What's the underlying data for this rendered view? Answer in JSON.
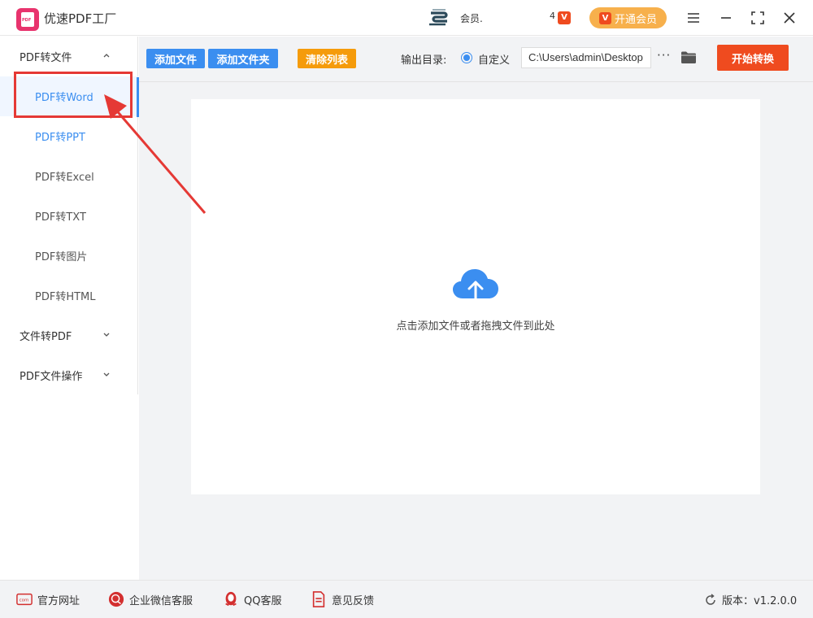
{
  "app": {
    "title": "优速PDF工厂",
    "logo_text": "PDF"
  },
  "titlebar": {
    "user_name": "会员.",
    "vip_small": "4",
    "vip_button": "开通会员",
    "vip_icon_letter": "V"
  },
  "sidebar": {
    "groups": [
      {
        "label": "PDF转文件",
        "expanded": true
      },
      {
        "label": "文件转PDF",
        "expanded": false
      },
      {
        "label": "PDF文件操作",
        "expanded": false
      }
    ],
    "items": [
      {
        "label": "PDF转Word",
        "active": true
      },
      {
        "label": "PDF转PPT"
      },
      {
        "label": "PDF转Excel"
      },
      {
        "label": "PDF转TXT"
      },
      {
        "label": "PDF转图片"
      },
      {
        "label": "PDF转HTML"
      }
    ]
  },
  "toolbar": {
    "add_file": "添加文件",
    "add_folder": "添加文件夹",
    "clear_list": "清除列表",
    "output_label": "输出目录:",
    "radio_label": "自定义",
    "output_path": "C:\\Users\\admin\\Desktop",
    "more": "···",
    "start": "开始转换"
  },
  "dropzone": {
    "hint": "点击添加文件或者拖拽文件到此处"
  },
  "footer": {
    "website": "官方网址",
    "wechat": "企业微信客服",
    "qq": "QQ客服",
    "feedback": "意见反馈",
    "version": "版本：v1.2.0.0"
  },
  "colors": {
    "accent_blue": "#3b8ef0",
    "start_red": "#ef4b1f",
    "clear_orange": "#f59b0b",
    "vip_orange": "#f7b04c",
    "highlight_red": "#e53935"
  }
}
